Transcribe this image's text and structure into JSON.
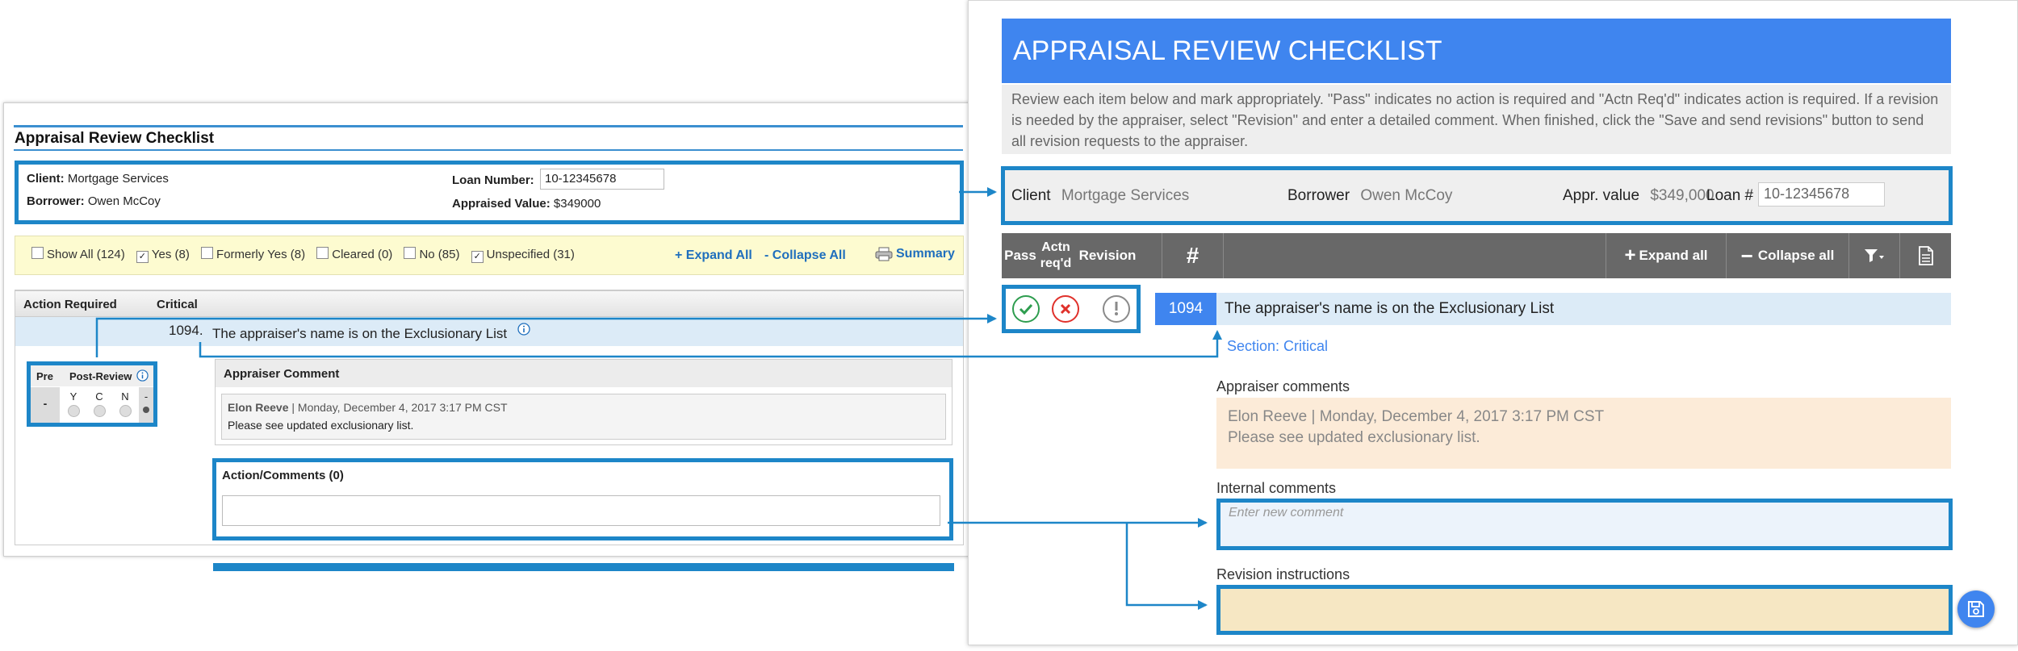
{
  "old_ui": {
    "title": "Appraisal Review Checklist",
    "client_label": "Client:",
    "client_value": "Mortgage Services",
    "borrower_label": "Borrower:",
    "borrower_value": "Owen McCoy",
    "loan_label": "Loan Number:",
    "loan_value": "10-12345678",
    "appraised_label": "Appraised Value:",
    "appraised_value": "$349000",
    "filters": [
      {
        "label": "Show All (124)",
        "checked": false
      },
      {
        "label": "Yes (8)",
        "checked": true
      },
      {
        "label": "Formerly Yes (8)",
        "checked": false
      },
      {
        "label": "Cleared (0)",
        "checked": false
      },
      {
        "label": "No (85)",
        "checked": false
      },
      {
        "label": "Unspecified (31)",
        "checked": true
      }
    ],
    "expand_all": "+ Expand All",
    "collapse_all": "- Collapse All",
    "summary": "Summary",
    "col_action_required": "Action Required",
    "col_critical": "Critical",
    "item_number": "1094.",
    "item_text": "The appraiser's name is on the Exclusionary List",
    "review": {
      "pre": "Pre",
      "post_review": "Post-Review",
      "pre_value": "-",
      "options": [
        "Y",
        "C",
        "N",
        "-"
      ],
      "selected": "-"
    },
    "appraiser_comment_title": "Appraiser Comment",
    "comment_author": "Elon Reeve",
    "comment_date": "| Monday, December 4, 2017 3:17 PM CST",
    "comment_text": "Please see updated exclusionary list.",
    "action_comments_title": "Action/Comments (0)"
  },
  "new_ui": {
    "title": "APPRAISAL REVIEW CHECKLIST",
    "intro": "Review each item below and mark appropriately. \"Pass\" indicates no action is required and \"Actn Req'd\" indicates action is required. If a revision is needed by the appraiser, select \"Revision\" and enter a detailed comment. When finished, click the \"Save and send revisions\" button to send all revision requests to the appraiser.",
    "client_label": "Client",
    "client_value": "Mortgage Services",
    "borrower_label": "Borrower",
    "borrower_value": "Owen McCoy",
    "appr_value_label": "Appr. value",
    "appr_value": "$349,000",
    "loan_label": "Loan #",
    "loan_value": "10-12345678",
    "toolbar": {
      "pass": "Pass",
      "actn_req_line1": "Actn",
      "actn_req_line2": "req'd",
      "revision": "Revision",
      "hash": "#",
      "expand_all": "Expand all",
      "collapse_all": "Collapse all"
    },
    "item_number": "1094",
    "item_text": "The appraiser's name is on the Exclusionary List",
    "section": "Section: Critical",
    "appraiser_comments_label": "Appraiser comments",
    "comment_author": "Elon Reeve",
    "comment_date": "| Monday, December 4, 2017 3:17 PM CST",
    "comment_text": "Please see updated exclusionary list.",
    "internal_comments_label": "Internal comments",
    "internal_placeholder": "Enter new comment",
    "revision_label": "Revision instructions"
  },
  "colors": {
    "accent_blue": "#3f85ef",
    "highlight_border": "#1d86c8",
    "pass_green": "#2e9d4f",
    "action_red": "#e0312b",
    "revision_gray": "#8a8a8a",
    "toolbar_gray": "#686868"
  },
  "icons": [
    "info-icon",
    "printer-icon",
    "check-icon",
    "x-icon",
    "exclamation-icon",
    "plus-icon",
    "minus-icon",
    "filter-icon",
    "document-icon",
    "save-icon"
  ]
}
